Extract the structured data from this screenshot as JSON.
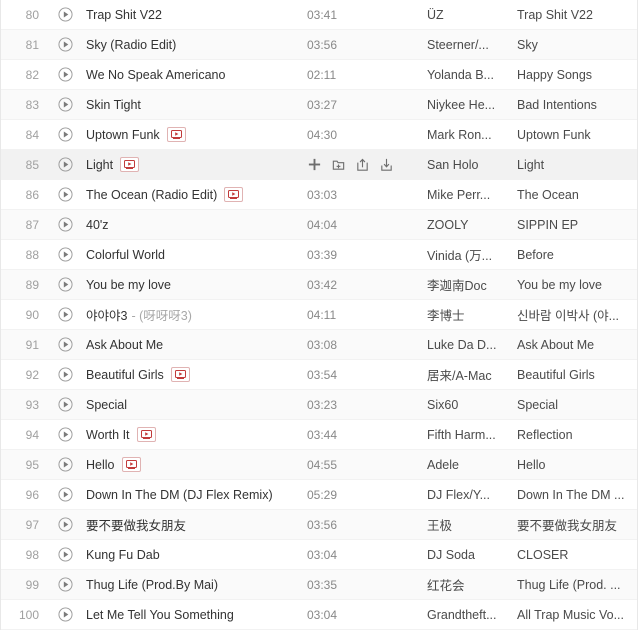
{
  "theme": {
    "row_bg": "#ffffff",
    "row_bg_alt": "#fafafa",
    "row_bg_hover": "#f2f2f2",
    "text_color": "#333333",
    "muted_color": "#a0a0a0",
    "mv_badge_color": "#c23b3b"
  },
  "icons": {
    "play": "play-circle-icon",
    "mv": "mv-badge-icon",
    "add": "plus-icon",
    "add_to_playlist": "add-to-folder-icon",
    "share": "share-icon",
    "download": "download-icon"
  },
  "hover_actions": [
    {
      "name": "add-icon",
      "label": "+"
    },
    {
      "name": "add-to-playlist-icon",
      "label": "Add to playlist"
    },
    {
      "name": "share-icon",
      "label": "Share"
    },
    {
      "name": "download-icon",
      "label": "Download"
    }
  ],
  "tracks": [
    {
      "index": "80",
      "title": "Trap Shit V22",
      "sub": "",
      "mv": false,
      "duration": "03:41",
      "artist": "ÜZ",
      "album": "Trap Shit V22"
    },
    {
      "index": "81",
      "title": "Sky (Radio Edit)",
      "sub": "",
      "mv": false,
      "duration": "03:56",
      "artist": "Steerner/...",
      "album": "Sky"
    },
    {
      "index": "82",
      "title": "We No Speak Americano",
      "sub": "",
      "mv": false,
      "duration": "02:11",
      "artist": "Yolanda B...",
      "album": "Happy Songs"
    },
    {
      "index": "83",
      "title": "Skin Tight",
      "sub": "",
      "mv": false,
      "duration": "03:27",
      "artist": "Niykee He...",
      "album": "Bad Intentions"
    },
    {
      "index": "84",
      "title": "Uptown Funk",
      "sub": "",
      "mv": true,
      "duration": "04:30",
      "artist": "Mark Ron...",
      "album": "Uptown Funk"
    },
    {
      "index": "85",
      "title": "Light",
      "sub": "",
      "mv": true,
      "duration": "",
      "artist": "San Holo",
      "album": "Light",
      "hover": true
    },
    {
      "index": "86",
      "title": "The Ocean (Radio Edit)",
      "sub": "",
      "mv": true,
      "duration": "03:03",
      "artist": "Mike Perr...",
      "album": "The Ocean"
    },
    {
      "index": "87",
      "title": "40'z",
      "sub": "",
      "mv": false,
      "duration": "04:04",
      "artist": "ZOOLY",
      "album": "SIPPIN EP"
    },
    {
      "index": "88",
      "title": "Colorful World",
      "sub": "",
      "mv": false,
      "duration": "03:39",
      "artist": "Vinida (万...",
      "album": "Before"
    },
    {
      "index": "89",
      "title": "You be my love",
      "sub": "",
      "mv": false,
      "duration": "03:42",
      "artist": "李迦南Doc",
      "album": "You be my love"
    },
    {
      "index": "90",
      "title": "야야야3",
      "sub": "- (呀呀呀3)",
      "mv": false,
      "duration": "04:11",
      "artist": "李博士",
      "album": "신바람 이박사 (야..."
    },
    {
      "index": "91",
      "title": "Ask About Me",
      "sub": "",
      "mv": false,
      "duration": "03:08",
      "artist": "Luke Da D...",
      "album": "Ask About Me"
    },
    {
      "index": "92",
      "title": "Beautiful Girls",
      "sub": "",
      "mv": true,
      "duration": "03:54",
      "artist": "居来/A-Mac",
      "album": "Beautiful Girls"
    },
    {
      "index": "93",
      "title": "Special",
      "sub": "",
      "mv": false,
      "duration": "03:23",
      "artist": "Six60",
      "album": "Special"
    },
    {
      "index": "94",
      "title": "Worth It",
      "sub": "",
      "mv": true,
      "duration": "03:44",
      "artist": "Fifth Harm...",
      "album": "Reflection"
    },
    {
      "index": "95",
      "title": "Hello",
      "sub": "",
      "mv": true,
      "duration": "04:55",
      "artist": "Adele",
      "album": "Hello"
    },
    {
      "index": "96",
      "title": "Down In The DM (DJ Flex Remix)",
      "sub": "",
      "mv": false,
      "duration": "05:29",
      "artist": "DJ Flex/Y...",
      "album": "Down In The DM ..."
    },
    {
      "index": "97",
      "title": "要不要做我女朋友",
      "sub": "",
      "mv": false,
      "duration": "03:56",
      "artist": "王极",
      "album": "要不要做我女朋友"
    },
    {
      "index": "98",
      "title": "Kung Fu Dab",
      "sub": "",
      "mv": false,
      "duration": "03:04",
      "artist": "DJ Soda",
      "album": "CLOSER"
    },
    {
      "index": "99",
      "title": "Thug Life (Prod.By Mai)",
      "sub": "",
      "mv": false,
      "duration": "03:35",
      "artist": "红花会",
      "album": "Thug Life (Prod. ..."
    },
    {
      "index": "100",
      "title": "Let Me Tell You Something",
      "sub": "",
      "mv": false,
      "duration": "03:04",
      "artist": "Grandtheft...",
      "album": "All Trap Music Vo..."
    }
  ]
}
